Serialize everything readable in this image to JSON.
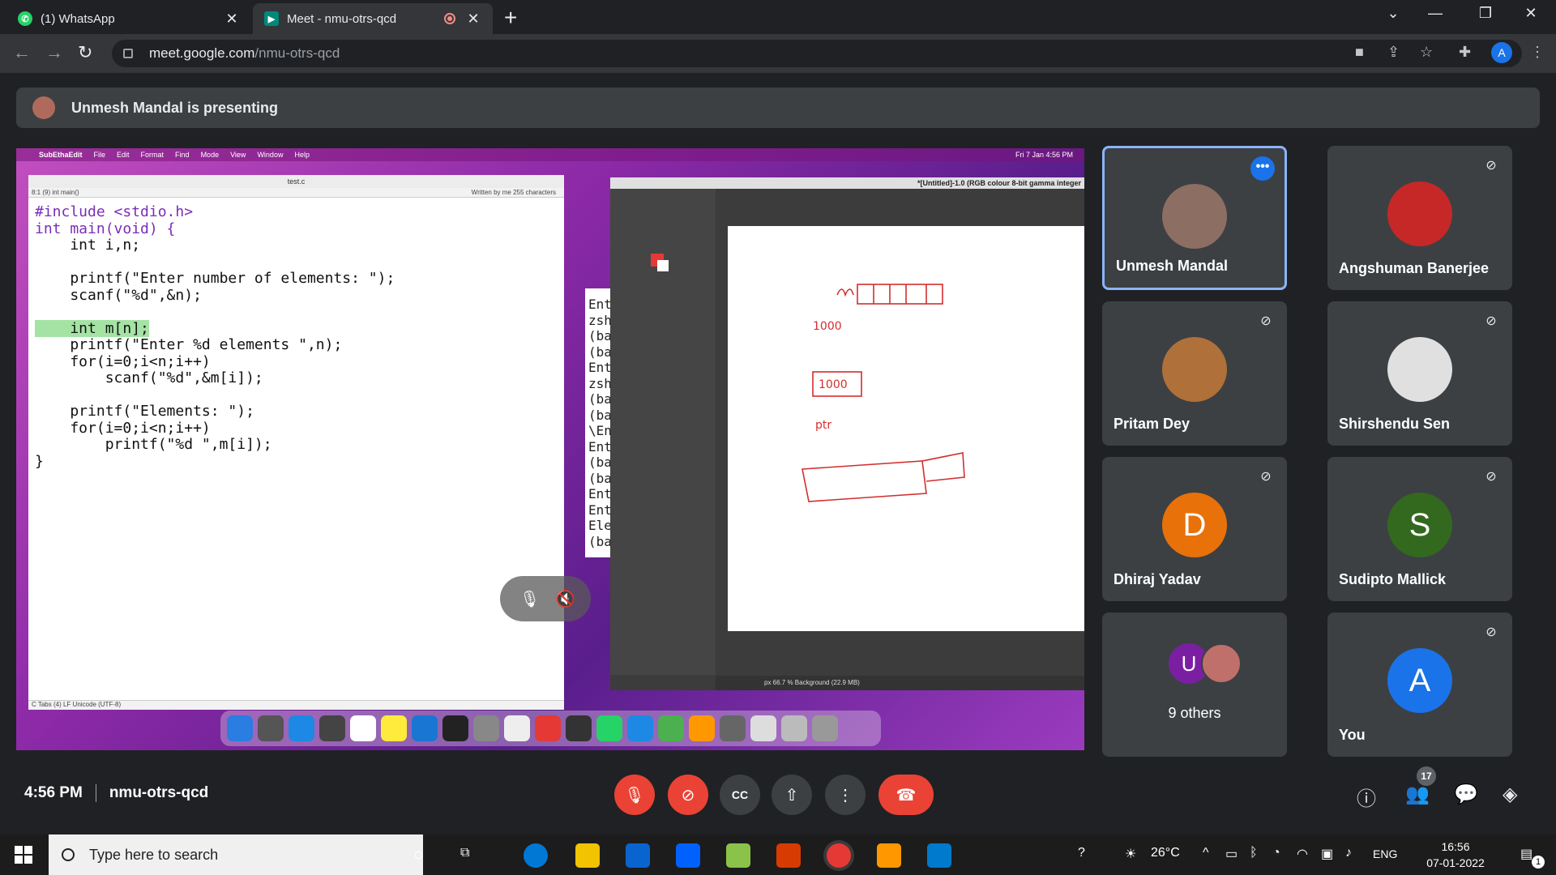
{
  "browser": {
    "tabs": [
      {
        "title": "(1) WhatsApp",
        "favicon": "whatsapp-icon",
        "favicon_color": "#25d366"
      },
      {
        "title": "Meet - nmu-otrs-qcd",
        "favicon": "meet-icon",
        "favicon_color": "#00897b"
      }
    ],
    "url_host": "meet.google.com",
    "url_path": "/nmu-otrs-qcd",
    "profile_initial": "A"
  },
  "banner": {
    "text": "Unmesh Mandal is presenting"
  },
  "shared_screen": {
    "menubar": {
      "app": "SubEthaEdit",
      "items": [
        "File",
        "Edit",
        "Format",
        "Find",
        "Mode",
        "View",
        "Window",
        "Help"
      ],
      "clock": "Fri 7 Jan  4:56 PM"
    },
    "editor": {
      "filename": "test.c",
      "info_left": "8:1 (9)   int main()",
      "info_right": "Written by me   255 characters",
      "status": "C   Tabs (4)   LF   Unicode (UTF-8)",
      "lines": [
        "#include <stdio.h>",
        "int main(void) {",
        "    int i,n;",
        "",
        "    printf(\"Enter number of elements: \");",
        "    scanf(\"%d\",&n);",
        "",
        "    int m[n];",
        "    printf(\"Enter %d elements \",n);",
        "    for(i=0;i<n;i++)",
        "        scanf(\"%d\",&m[i]);",
        "",
        "    printf(\"Elements: \");",
        "    for(i=0;i<n;i++)",
        "        printf(\"%d \",m[i]);",
        "}"
      ]
    },
    "terminal_lines": [
      "Ent",
      "zsh",
      "(ba",
      "(ba",
      "Ent",
      "zsh",
      "(ba",
      "(ba",
      "\\En",
      "Ent",
      "(ba",
      "(ba",
      "Ent",
      "Ent",
      "Ele",
      "(ba"
    ],
    "gimp": {
      "title": "*[Untitled]-1.0 (RGB colour 8-bit gamma integer",
      "status": "px   66.7 %   Background (22.9 MB)"
    }
  },
  "participants": [
    {
      "name": "Unmesh Mandal",
      "speaking": true,
      "avatar_color": "#8d6e63"
    },
    {
      "name": "Angshuman Banerjee",
      "muted": true,
      "avatar_color": "#c62828"
    },
    {
      "name": "Pritam Dey",
      "muted": true,
      "avatar_color": "#b0703a"
    },
    {
      "name": "Shirshendu Sen",
      "muted": true,
      "avatar_color": "#e0e0e0"
    },
    {
      "name": "Dhiraj Yadav",
      "muted": true,
      "initial": "D",
      "avatar_color": "#e8710a"
    },
    {
      "name": "Sudipto Mallick",
      "muted": true,
      "initial": "S",
      "avatar_color": "#33691e"
    },
    {
      "name": "9 others",
      "initial": "U",
      "avatar_color": "#7b1fa2"
    },
    {
      "name": "You",
      "muted": true,
      "initial": "A",
      "avatar_color": "#1a73e8"
    }
  ],
  "meeting": {
    "time": "4:56 PM",
    "code": "nmu-otrs-qcd",
    "participant_count": "17"
  },
  "taskbar": {
    "search_placeholder": "Type here to search",
    "weather": "26°C",
    "language": "ENG",
    "time": "16:56",
    "date": "07-01-2022",
    "notification_count": "1"
  }
}
